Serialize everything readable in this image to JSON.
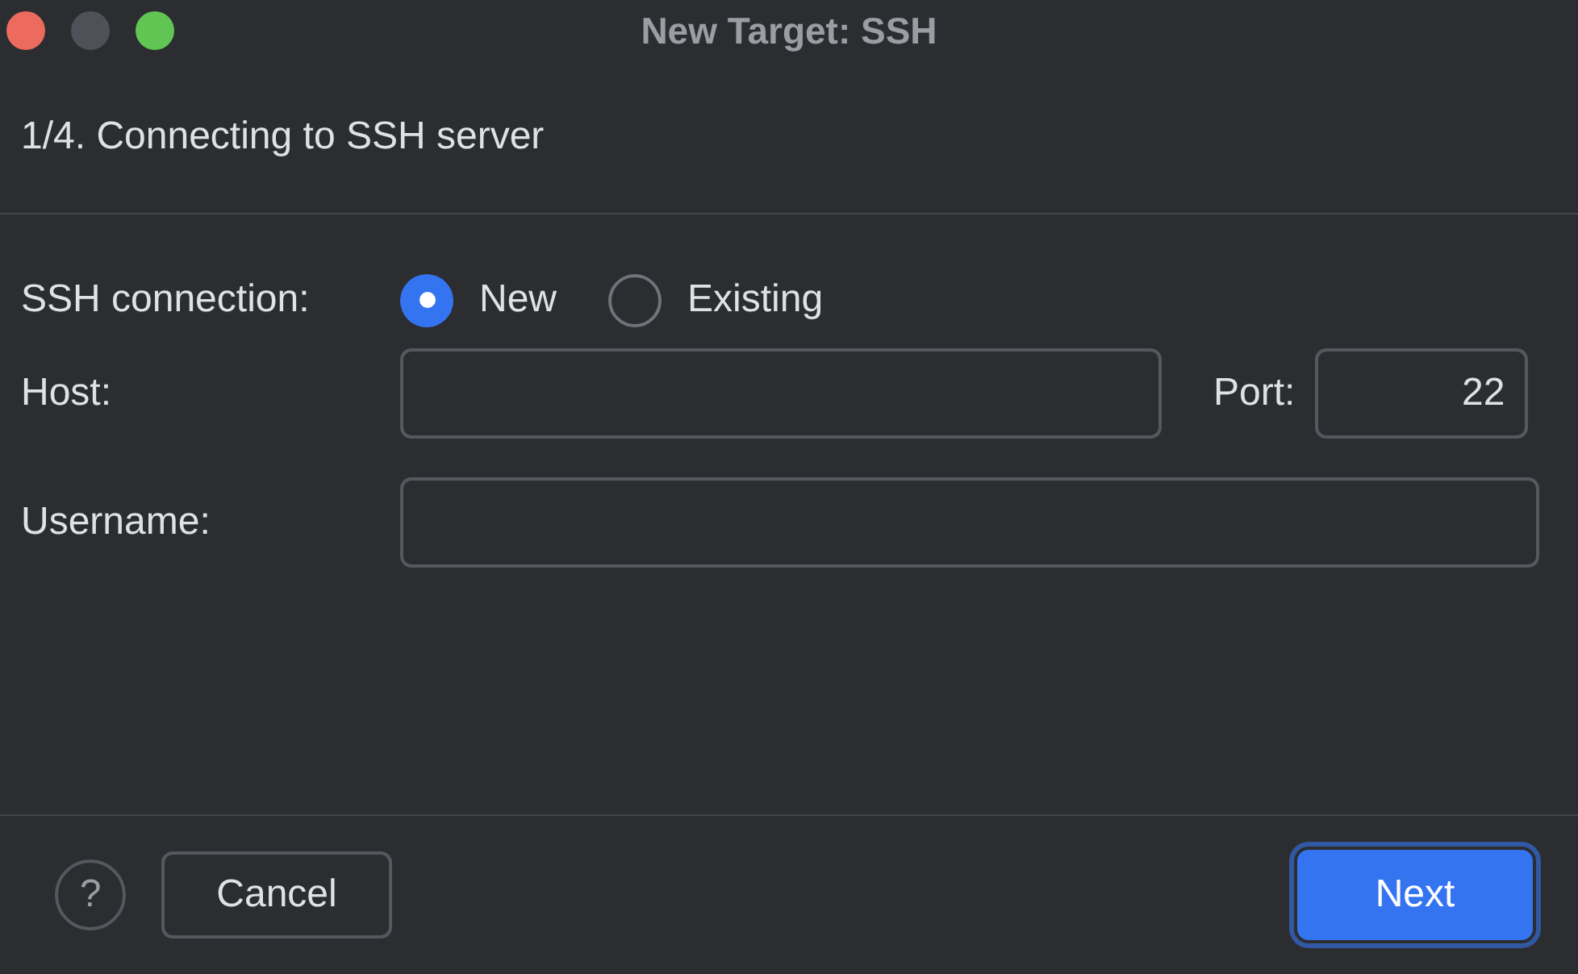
{
  "window": {
    "title": "New Target: SSH"
  },
  "step_title": "1/4. Connecting to SSH server",
  "ssh_connection": {
    "label": "SSH connection:",
    "options": [
      {
        "label": "New",
        "selected": true
      },
      {
        "label": "Existing",
        "selected": false
      }
    ]
  },
  "host": {
    "label": "Host:"
  },
  "port": {
    "label": "Port:",
    "value": "22"
  },
  "username": {
    "label": "Username:"
  },
  "footer": {
    "help": "?",
    "buttons": [
      {
        "label": "Cancel",
        "primary": false
      },
      {
        "label": "Next",
        "primary": true
      }
    ]
  }
}
